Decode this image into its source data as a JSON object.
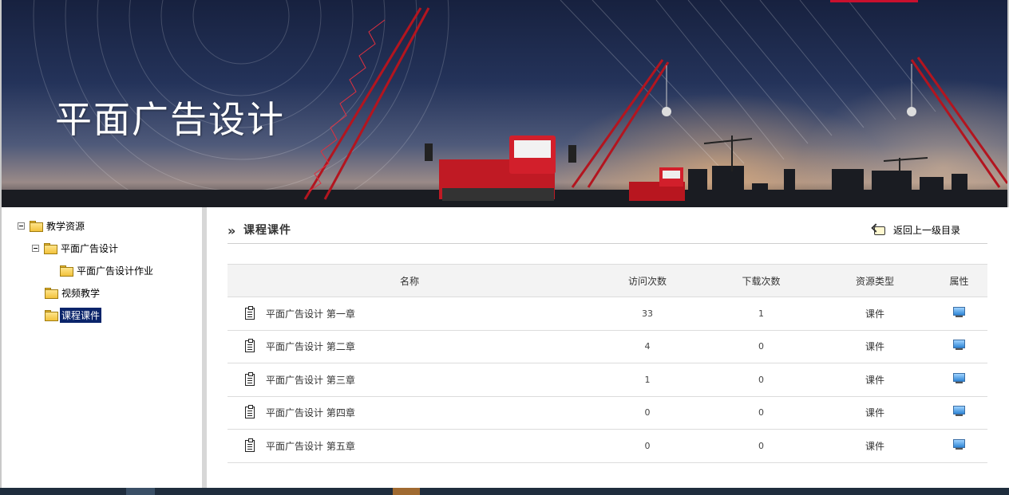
{
  "banner": {
    "title": "平面广告设计"
  },
  "sidebar": {
    "items": [
      {
        "label": "教学资源",
        "level": 0,
        "expanded": true,
        "selected": false
      },
      {
        "label": "平面广告设计",
        "level": 1,
        "expanded": true,
        "selected": false
      },
      {
        "label": "平面广告设计作业",
        "level": 2,
        "expanded": false,
        "selected": false
      },
      {
        "label": "视频教学",
        "level": 1,
        "expanded": false,
        "selected": false
      },
      {
        "label": "课程课件",
        "level": 1,
        "expanded": false,
        "selected": true
      }
    ]
  },
  "main": {
    "section_arrow": "»",
    "section_title": "课程课件",
    "back_label": "返回上一级目录",
    "columns": [
      "名称",
      "访问次数",
      "下载次数",
      "资源类型",
      "属性"
    ],
    "rows": [
      {
        "name": "平面广告设计  第一章",
        "visits": "33",
        "downloads": "1",
        "type": "课件"
      },
      {
        "name": "平面广告设计  第二章",
        "visits": "4",
        "downloads": "0",
        "type": "课件"
      },
      {
        "name": "平面广告设计  第三章",
        "visits": "1",
        "downloads": "0",
        "type": "课件"
      },
      {
        "name": "平面广告设计  第四章",
        "visits": "0",
        "downloads": "0",
        "type": "课件"
      },
      {
        "name": "平面广告设计  第五章",
        "visits": "0",
        "downloads": "0",
        "type": "课件"
      }
    ]
  },
  "icons": {
    "tree_folder": "folder-icon",
    "tree_toggle": "collapse-toggle-icon",
    "back": "back-arrow-icon",
    "document": "document-icon",
    "properties": "monitor-icon"
  },
  "colors": {
    "accent": "#c8102e",
    "selected_bg": "#0a246a",
    "header_bg": "#f3f3f3"
  }
}
